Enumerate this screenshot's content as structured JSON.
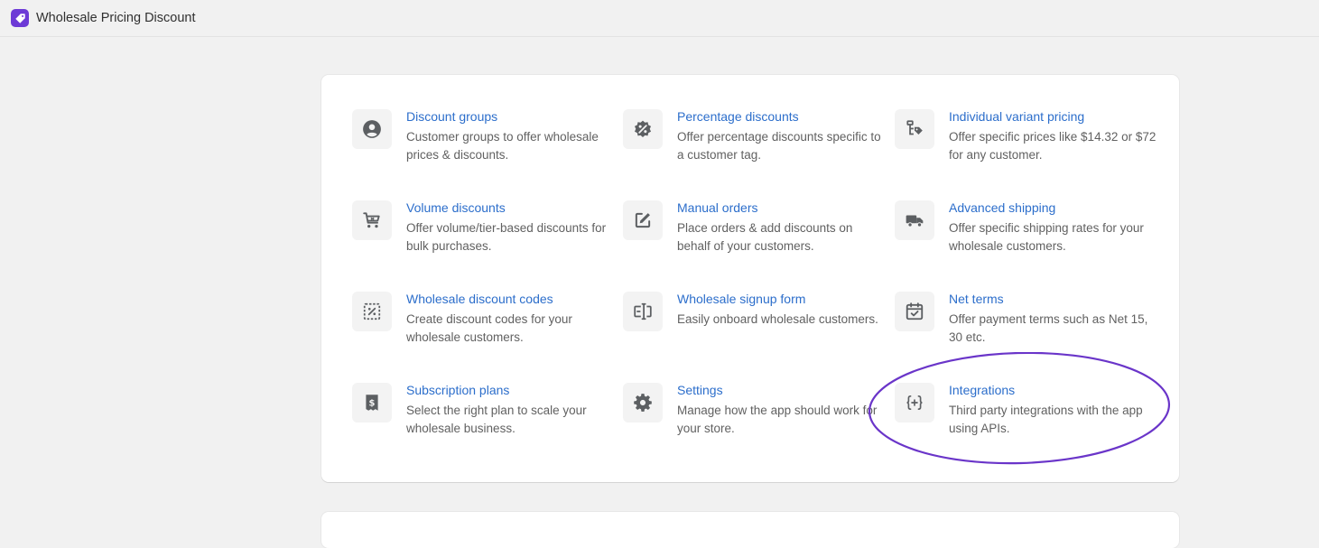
{
  "header": {
    "app_title": "Wholesale Pricing Discount",
    "logo_icon": "tag-icon",
    "logo_color": "#6d3ad6"
  },
  "features": [
    {
      "title": "Discount groups",
      "description": "Customer groups to offer wholesale prices & discounts.",
      "icon": "person-icon"
    },
    {
      "title": "Percentage discounts",
      "description": "Offer percentage discounts specific to a customer tag.",
      "icon": "percent-badge-icon"
    },
    {
      "title": "Individual variant pricing",
      "description": "Offer specific prices like $14.32 or $72 for any customer.",
      "icon": "variant-tag-icon"
    },
    {
      "title": "Volume discounts",
      "description": "Offer volume/tier-based discounts for bulk purchases.",
      "icon": "cart-icon"
    },
    {
      "title": "Manual orders",
      "description": "Place orders & add discounts on behalf of your customers.",
      "icon": "edit-icon"
    },
    {
      "title": "Advanced shipping",
      "description": "Offer specific shipping rates for your wholesale customers.",
      "icon": "truck-icon"
    },
    {
      "title": "Wholesale discount codes",
      "description": "Create discount codes for your wholesale customers.",
      "icon": "discount-code-icon"
    },
    {
      "title": "Wholesale signup form",
      "description": "Easily onboard wholesale customers.",
      "icon": "form-icon"
    },
    {
      "title": "Net terms",
      "description": "Offer payment terms such as Net 15, 30 etc.",
      "icon": "calendar-check-icon"
    },
    {
      "title": "Subscription plans",
      "description": "Select the right plan to scale your wholesale business.",
      "icon": "receipt-dollar-icon"
    },
    {
      "title": "Settings",
      "description": "Manage how the app should work for your store.",
      "icon": "gear-icon"
    },
    {
      "title": "Integrations",
      "description": "Third party integrations with the app using APIs.",
      "icon": "code-braces-icon"
    }
  ],
  "colors": {
    "link": "#2c6ecb",
    "highlight": "#6a35c9"
  }
}
